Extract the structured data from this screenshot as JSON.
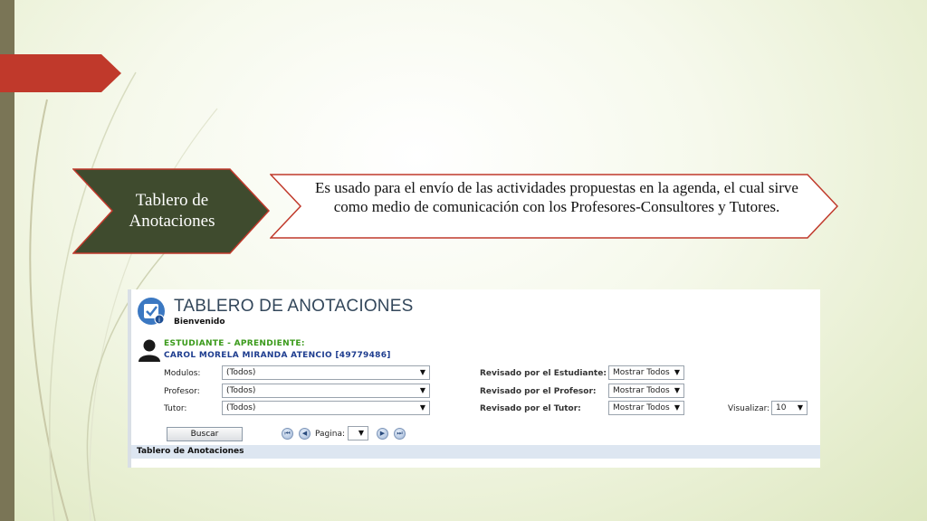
{
  "slide": {
    "title": "Tablero de Anotaciones",
    "description": "Es usado para el envío de las actividades propuestas en la agenda, el cual sirve como medio de comunicación con los Profesores-Consultores y Tutores.",
    "colors": {
      "title_fill": "#3f4b2e",
      "accent_red": "#c0392b",
      "left_bar": "#7a7556"
    }
  },
  "app": {
    "title": "TABLERO DE ANOTACIONES",
    "welcome": "Bienvenido",
    "user_role": "ESTUDIANTE - APRENDIENTE:",
    "user_name": "CAROL MORELA MIRANDA ATENCIO [49779486]",
    "filters": {
      "modulos_label": "Modulos:",
      "modulos_value": "(Todos)",
      "profesor_label": "Profesor:",
      "profesor_value": "(Todos)",
      "tutor_label": "Tutor:",
      "tutor_value": "(Todos)",
      "rev_estudiante_label": "Revisado por el Estudiante:",
      "rev_estudiante_value": "Mostrar Todos",
      "rev_profesor_label": "Revisado por el Profesor:",
      "rev_profesor_value": "Mostrar Todos",
      "rev_tutor_label": "Revisado por el Tutor:",
      "rev_tutor_value": "Mostrar Todos",
      "visualizar_label": "Visualizar:",
      "visualizar_value": "10"
    },
    "search_button": "Buscar",
    "pager": {
      "label": "Pagina:",
      "value": ""
    },
    "section_header": "Tablero de Anotaciones"
  }
}
